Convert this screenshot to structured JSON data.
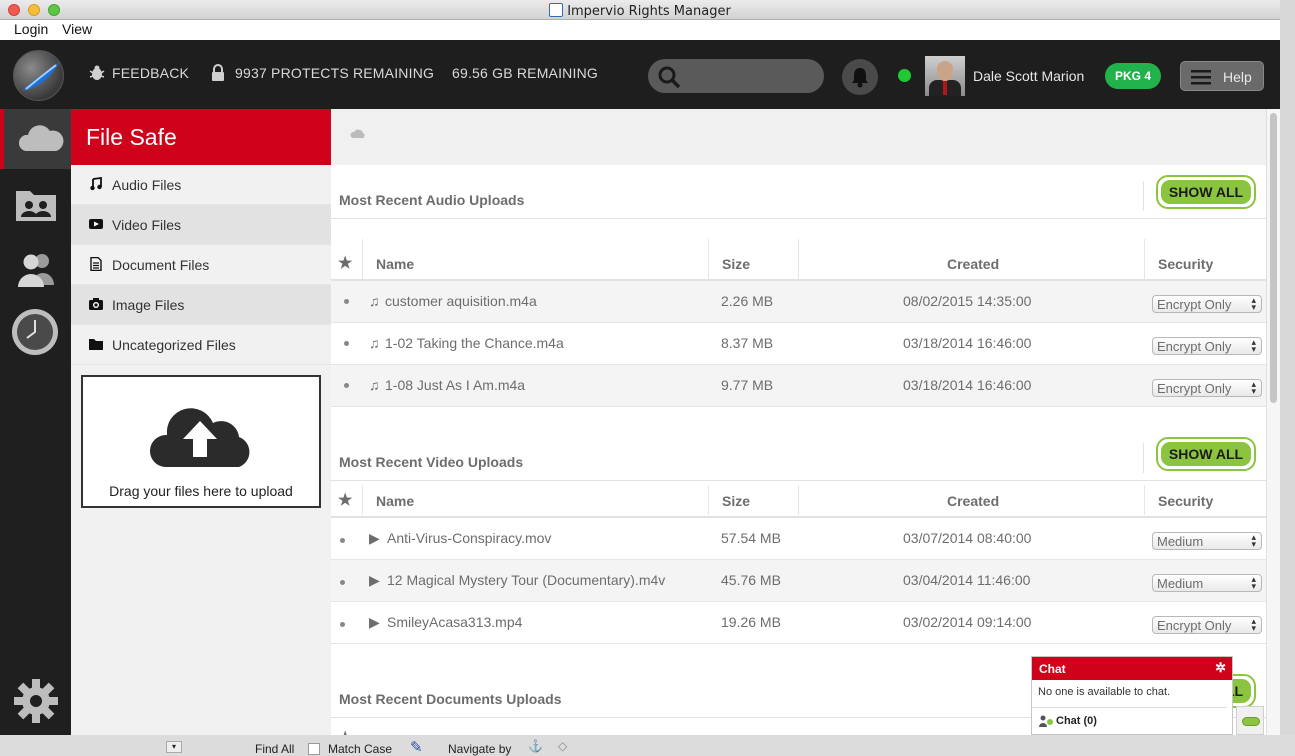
{
  "window": {
    "title": "Impervio Rights Manager"
  },
  "menu": [
    "Login",
    "View"
  ],
  "header": {
    "feedback": "FEEDBACK",
    "protects": "9937 PROTECTS REMAINING",
    "storage": "69.56 GB REMAINING",
    "search_placeholder": "",
    "user_name": "Dale Scott Marion",
    "package": "PKG 4",
    "help": "Help"
  },
  "sidebar": {
    "title": "File Safe",
    "items": [
      {
        "label": "Audio Files",
        "icon": "music-note-icon"
      },
      {
        "label": "Video Files",
        "icon": "play-icon"
      },
      {
        "label": "Document Files",
        "icon": "document-icon"
      },
      {
        "label": "Image Files",
        "icon": "camera-icon"
      },
      {
        "label": "Uncategorized Files",
        "icon": "folder-icon"
      }
    ],
    "upload_text": "Drag your files here to upload"
  },
  "columns": {
    "name": "Name",
    "size": "Size",
    "created": "Created",
    "security": "Security"
  },
  "show_all": "SHOW ALL",
  "sections": [
    {
      "title": "Most Recent Audio Uploads",
      "rows": [
        {
          "name": "customer aquisition.m4a",
          "size": "2.26 MB",
          "created": "08/02/2015 14:35:00",
          "security": "Encrypt Only"
        },
        {
          "name": "1-02 Taking the Chance.m4a",
          "size": "8.37 MB",
          "created": "03/18/2014 16:46:00",
          "security": "Encrypt Only"
        },
        {
          "name": "1-08 Just As I Am.m4a",
          "size": "9.77 MB",
          "created": "03/18/2014 16:46:00",
          "security": "Encrypt Only"
        }
      ]
    },
    {
      "title": "Most Recent Video Uploads",
      "rows": [
        {
          "name": "Anti-Virus-Conspiracy.mov",
          "size": "57.54 MB",
          "created": "03/07/2014 08:40:00",
          "security": "Medium"
        },
        {
          "name": "12 Magical Mystery Tour (Documentary).m4v",
          "size": "45.76 MB",
          "created": "03/04/2014 11:46:00",
          "security": "Medium"
        },
        {
          "name": "SmileyAcasa313.mp4",
          "size": "19.26 MB",
          "created": "03/02/2014 09:14:00",
          "security": "Encrypt Only"
        }
      ]
    },
    {
      "title": "Most Recent Documents Uploads",
      "rows": []
    }
  ],
  "chat": {
    "title": "Chat",
    "message": "No one is available to chat.",
    "footer": "Chat (0)"
  },
  "bottom_bar": {
    "find_all": "Find All",
    "match_case": "Match Case",
    "navigate_by": "Navigate by"
  },
  "colors": {
    "accent": "#d0021b",
    "show_all": "#8bc53f",
    "online": "#1fc934"
  }
}
